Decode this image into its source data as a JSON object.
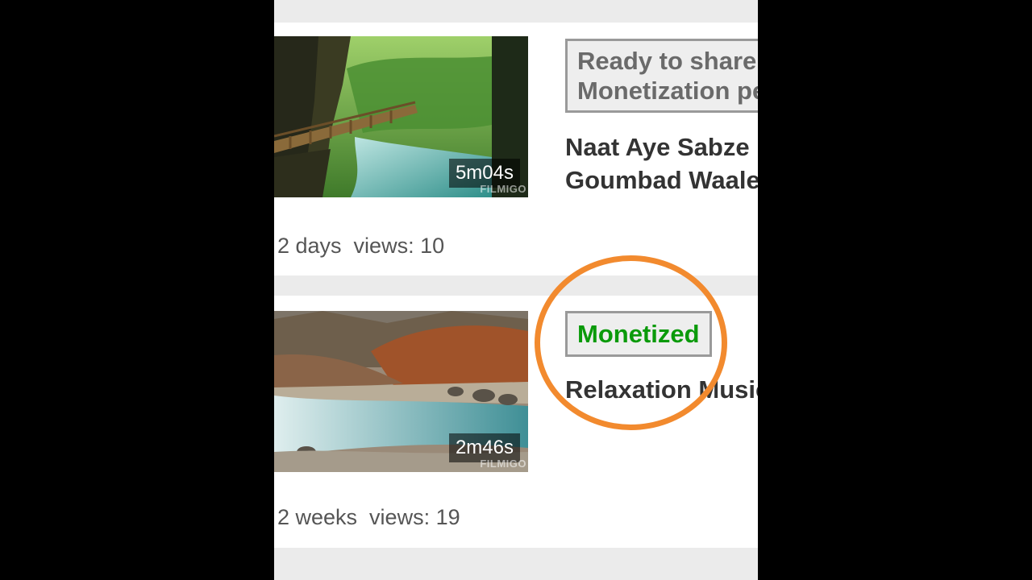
{
  "videos": [
    {
      "duration": "5m04s",
      "watermark": "FILMIGO",
      "status": "Ready to share. Monetization pe",
      "title_line1": "Naat Aye Sabze",
      "title_line2": "Goumbad Waale",
      "meta": ": 2 days  views: 10"
    },
    {
      "duration": "2m46s",
      "watermark": "FILMIGO",
      "status": "Monetized",
      "title_line1": "Relaxation Music",
      "meta": ": 2 weeks  views: 19"
    }
  ],
  "colors": {
    "monetized_green": "#0a9a0a",
    "pending_gray": "#6a6a6a",
    "highlight_orange": "#f28a2e"
  }
}
